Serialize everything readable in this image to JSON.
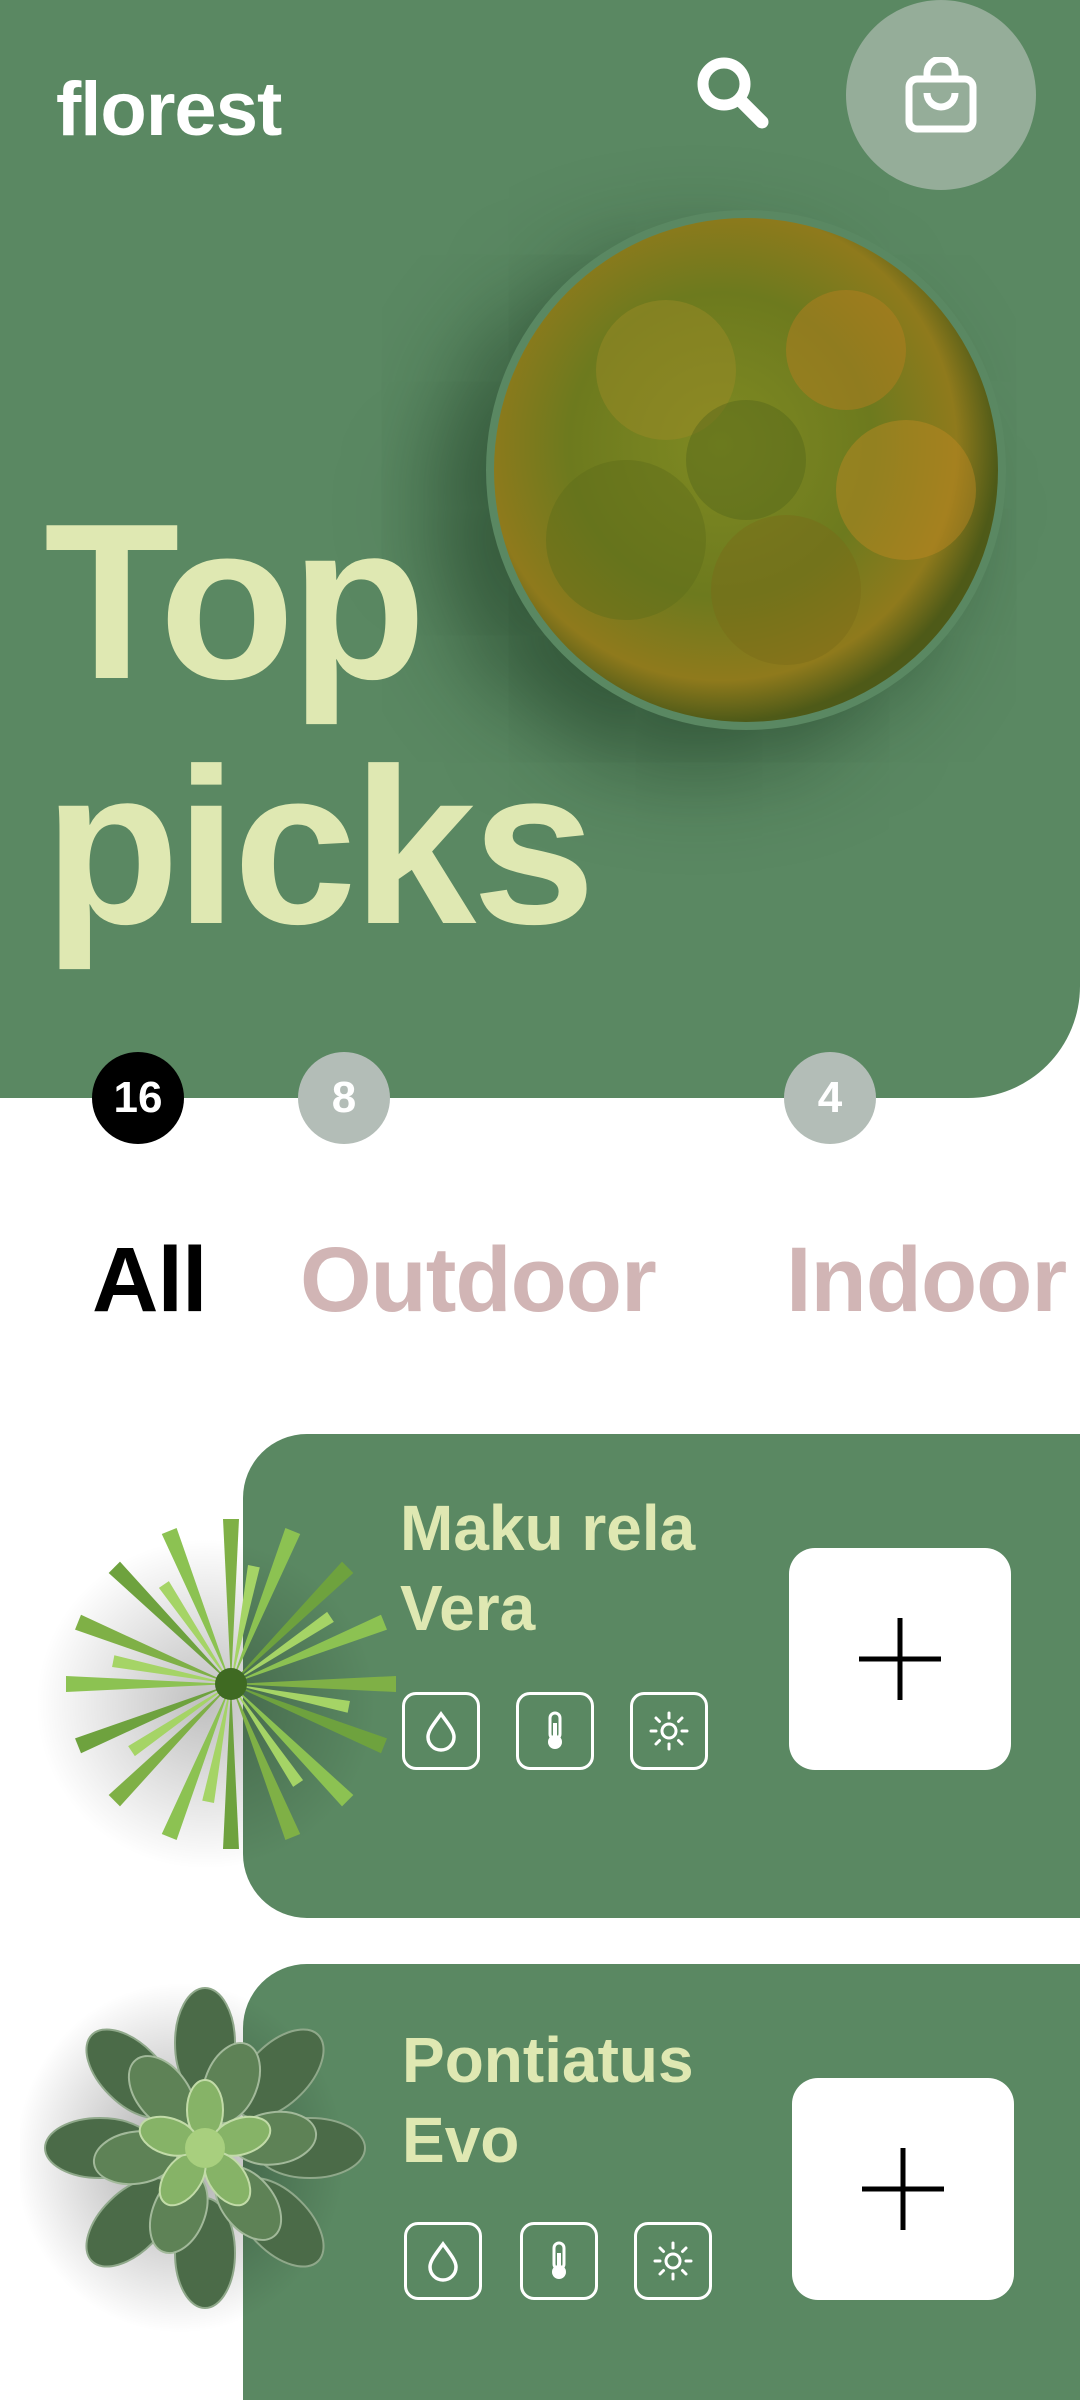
{
  "app": {
    "brand": "florest"
  },
  "header": {
    "search_icon": "search-icon",
    "bag_icon": "shopping-bag-icon"
  },
  "hero": {
    "headline_line1": "Top",
    "headline_line2": "picks"
  },
  "categories": [
    {
      "label": "All",
      "count": "16",
      "active": true
    },
    {
      "label": "Outdoor",
      "count": "8",
      "active": false
    },
    {
      "label": "Indoor",
      "count": "4",
      "active": false
    }
  ],
  "products": [
    {
      "name_line1": "Maku rela",
      "name_line2": "Vera",
      "care_icons": [
        "water-drop-icon",
        "thermometer-icon",
        "sun-icon"
      ]
    },
    {
      "name_line1": "Pontiatus",
      "name_line2": "Evo",
      "care_icons": [
        "water-drop-icon",
        "thermometer-icon",
        "sun-icon"
      ]
    }
  ],
  "colors": {
    "hero_green": "#5a8862",
    "headline": "#dfe8b2",
    "muted_tab": "#d1b5b5",
    "muted_badge": "#b3bdb7",
    "bag_circle": "#95ad99"
  }
}
